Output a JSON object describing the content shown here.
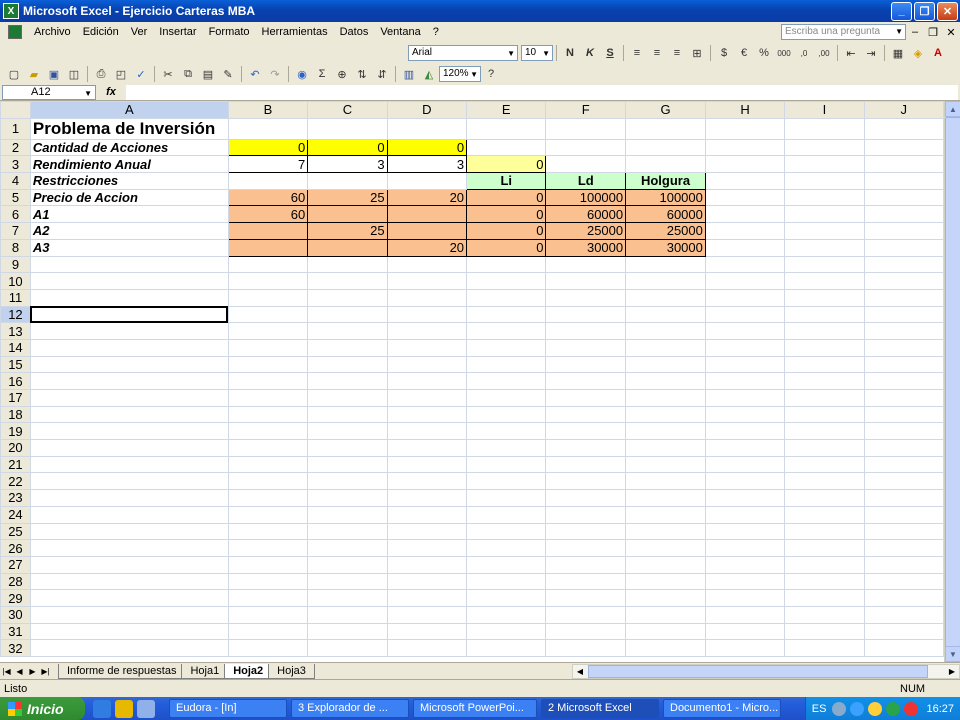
{
  "window": {
    "title": "Microsoft Excel - Ejercicio Carteras MBA",
    "app_icon": "excel-icon"
  },
  "menubar": {
    "items": [
      "Archivo",
      "Edición",
      "Ver",
      "Insertar",
      "Formato",
      "Herramientas",
      "Datos",
      "Ventana",
      "?"
    ],
    "ask_placeholder": "Escriba una pregunta"
  },
  "format_toolbar": {
    "font": "Arial",
    "size": "10",
    "bold": "N",
    "italic": "K",
    "underline": "S"
  },
  "standard_toolbar": {
    "zoom": "120%"
  },
  "formula_bar": {
    "name_box": "A12",
    "fx": "fx",
    "content": ""
  },
  "sheet": {
    "columns": [
      "A",
      "B",
      "C",
      "D",
      "E",
      "F",
      "G",
      "H",
      "I",
      "J"
    ],
    "selected_column": "A",
    "selected_row": 12,
    "active_cell": "A12",
    "row_count": 32,
    "cells": {
      "A1": "Problema de Inversión",
      "A2": "Cantidad de Acciones",
      "B2": "0",
      "C2": "0",
      "D2": "0",
      "A3": "Rendimiento Anual",
      "B3": "7",
      "C3": "3",
      "D3": "3",
      "E3": "0",
      "A4": "Restricciones",
      "E4": "Li",
      "F4": "Ld",
      "G4": "Holgura",
      "A5": "Precio de Accion",
      "B5": "60",
      "C5": "25",
      "D5": "20",
      "E5": "0",
      "F5": "100000",
      "G5": "100000",
      "A6": "A1",
      "B6": "60",
      "E6": "0",
      "F6": "60000",
      "G6": "60000",
      "A7": "A2",
      "C7": "25",
      "E7": "0",
      "F7": "25000",
      "G7": "25000",
      "A8": "A3",
      "D8": "20",
      "E8": "0",
      "F8": "30000",
      "G8": "30000"
    },
    "fills": {
      "yellow": "#ffff00",
      "light_yellow": "#ffff99",
      "green": "#ccffcc",
      "peach": "#fac090"
    }
  },
  "tabs": {
    "items": [
      "Informe de respuestas",
      "Hoja1",
      "Hoja2",
      "Hoja3"
    ],
    "active": "Hoja2"
  },
  "status": {
    "left": "Listo",
    "num": "NUM"
  },
  "taskbar": {
    "start": "Inicio",
    "buttons": [
      "Eudora - [In]",
      "3 Explorador de ...",
      "Microsoft PowerPoi...",
      "2 Microsoft Excel",
      "Documento1 - Micro..."
    ],
    "active_index": 3,
    "tray_lang": "ES",
    "clock": "16:27"
  }
}
